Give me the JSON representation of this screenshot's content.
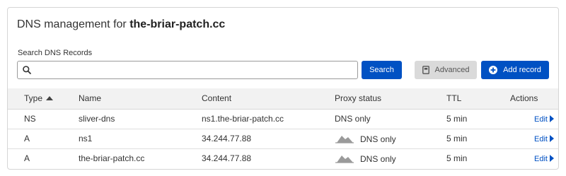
{
  "header": {
    "title_prefix": "DNS management for",
    "zone_name": "the-briar-patch.cc"
  },
  "search": {
    "label": "Search DNS Records",
    "value": "",
    "placeholder": ""
  },
  "toolbar": {
    "search_label": "Search",
    "advanced_label": "Advanced",
    "add_record_label": "Add record"
  },
  "table": {
    "columns": {
      "type": "Type",
      "name": "Name",
      "content": "Content",
      "proxy_status": "Proxy status",
      "ttl": "TTL",
      "actions": "Actions"
    },
    "sort": {
      "column": "type",
      "direction": "ascending"
    },
    "rows": [
      {
        "type": "NS",
        "name": "sliver-dns",
        "content": "ns1.the-briar-patch.cc",
        "proxy_status": "DNS only",
        "proxy_icon": false,
        "ttl": "5 min",
        "action": "Edit"
      },
      {
        "type": "A",
        "name": "ns1",
        "content": "34.244.77.88",
        "proxy_status": "DNS only",
        "proxy_icon": true,
        "ttl": "5 min",
        "action": "Edit"
      },
      {
        "type": "A",
        "name": "the-briar-patch.cc",
        "content": "34.244.77.88",
        "proxy_status": "DNS only",
        "proxy_icon": true,
        "ttl": "5 min",
        "action": "Edit"
      }
    ]
  },
  "colors": {
    "primary": "#0051c3",
    "secondary_button": "#dadada",
    "header_row": "#f2f2f2",
    "cloud_grey": "#9a9a9a"
  },
  "icons": {
    "search": "magnifier-icon",
    "advanced": "document-icon",
    "add": "plus-circle-icon",
    "proxy": "cloud-icon",
    "edit": "caret-right-icon",
    "sort": "sort-ascending-icon"
  }
}
